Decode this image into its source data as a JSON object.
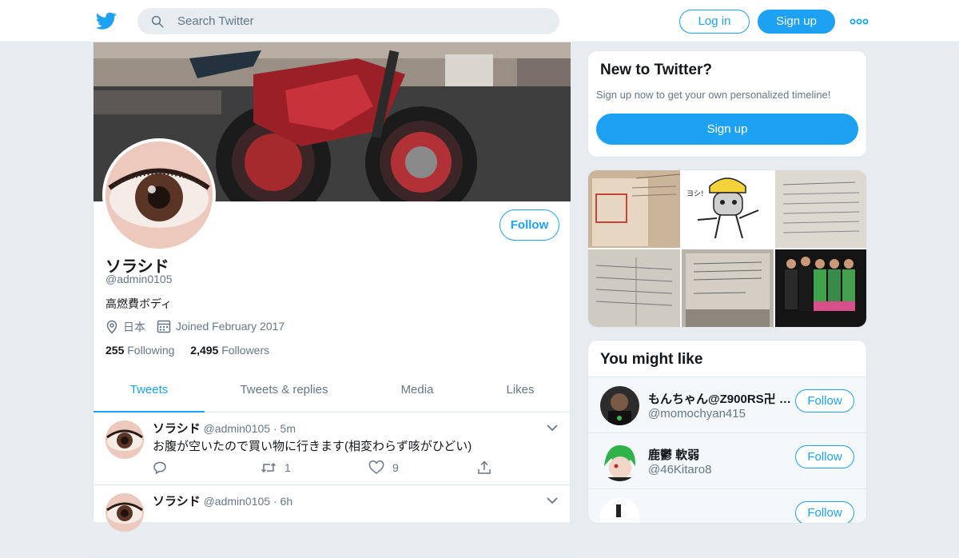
{
  "nav": {
    "logo_icon": "twitter-bird-icon",
    "search_placeholder": "Search Twitter",
    "login_label": "Log in",
    "signup_label": "Sign up",
    "more_icon": "more-dots-icon"
  },
  "profile": {
    "name": "ソラシド",
    "handle": "@admin0105",
    "bio": "高燃費ボディ",
    "location": "日本",
    "joined": "Joined February 2017",
    "following_count": "255",
    "following_label": "Following",
    "followers_count": "2,495",
    "followers_label": "Followers",
    "follow_label": "Follow"
  },
  "tabs": [
    {
      "label": "Tweets",
      "active": true
    },
    {
      "label": "Tweets & replies",
      "active": false
    },
    {
      "label": "Media",
      "active": false
    },
    {
      "label": "Likes",
      "active": false
    }
  ],
  "tweets": [
    {
      "name": "ソラシド",
      "handle": "@admin0105",
      "time": "· 5m",
      "text": "お腹が空いたので買い物に行きます(相変わらず咳がひどい)",
      "retweets": "1",
      "likes": "9"
    },
    {
      "name": "ソラシド",
      "handle": "@admin0105",
      "time": "· 6h",
      "text": "",
      "retweets": "",
      "likes": ""
    }
  ],
  "new_to_twitter": {
    "title": "New to Twitter?",
    "text": "Sign up now to get your own personalized timeline!",
    "button": "Sign up"
  },
  "you_might_like": {
    "title": "You might like",
    "follow_label": "Follow",
    "accounts": [
      {
        "name": "もんちゃん@Z900RS卍 …",
        "handle": "@momochyan415"
      },
      {
        "name": "鹿鬱 軟弱",
        "handle": "@46Kitaro8"
      }
    ]
  },
  "colors": {
    "brand": "#1da1f2",
    "text": "#14171a",
    "secondary": "#657786",
    "background": "#e6ecf0"
  }
}
